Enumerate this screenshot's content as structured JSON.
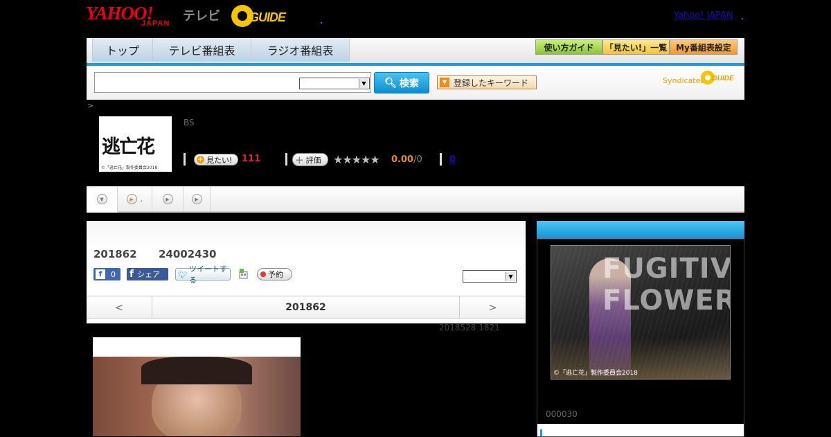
{
  "header": {
    "yahoo_logo_text": "YAHOO!",
    "yahoo_logo_sub": "JAPAN",
    "tv_label": "テレビ",
    "gguide_logo_text": "GUIDE",
    "yahoo_japan_link": "Yahoo! JAPAN"
  },
  "nav": {
    "tabs": [
      "トップ",
      "テレビ番組表",
      "ラジオ番組表"
    ],
    "utility_buttons": [
      "使い方ガイド",
      "「見たい!」一覧",
      "My番組表設定"
    ]
  },
  "search": {
    "input_value": "",
    "select_value": "",
    "button_label": "検索",
    "keyword_button_label": "登録したキーワード",
    "syndicated_label": "Syndicated",
    "syndicated_logo_text": "GUIDE"
  },
  "breadcrumb": ">",
  "program": {
    "thumbnail_title": "逃亡花",
    "thumbnail_copyright": "©「逃亡花」製作委員会2018",
    "channel": "BS",
    "want_label": "見たい!",
    "want_count": "111",
    "rate_label": "評価",
    "stars": "★★★★★",
    "rating_value": "0.00",
    "rating_count": "/0",
    "review_count": "0"
  },
  "tabs_strip": {
    "second_tab_text": "."
  },
  "main": {
    "broadcast_date": "201862",
    "broadcast_time": "24002430",
    "fb_like_count": "0",
    "fb_share_label": "シェア",
    "tweet_label": "ツイートする",
    "reserve_label": "予約",
    "panel_select_value": "",
    "prev_label": "<",
    "next_label": ">",
    "nav_date": "201862",
    "update_stamp": "2018528  1821"
  },
  "sidebar": {
    "poster_title": "FUGITIVE FLOWER",
    "poster_copyright": "©「逃亡花」製作委員会2018",
    "code": "000030"
  },
  "colors": {
    "accent_blue": "#1d9ad8",
    "want_count": "#e0203a",
    "rating": "#e08a3a",
    "link": "#1a0dab"
  }
}
